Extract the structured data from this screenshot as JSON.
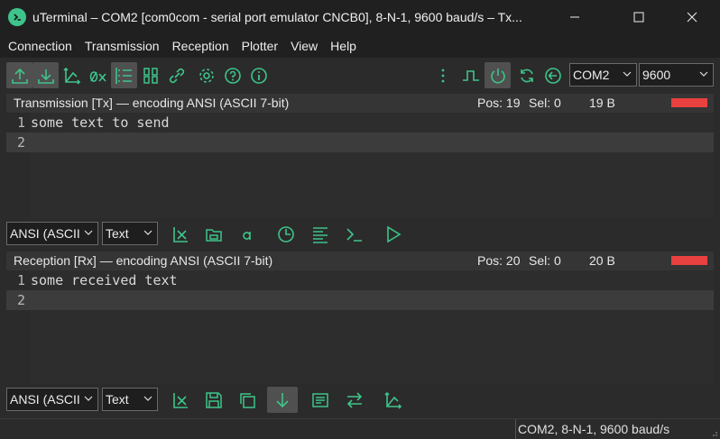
{
  "window": {
    "title": "uTerminal – COM2   [com0com - serial port emulator CNCB0], 8-N-1, 9600 baud/s – Tx..."
  },
  "menu": {
    "items": [
      "Connection",
      "Transmission",
      "Reception",
      "Plotter",
      "View",
      "Help"
    ]
  },
  "toolbar": {
    "port_value": "COM2",
    "baud_value": "9600"
  },
  "tx_panel": {
    "header": "Transmission [Tx] — encoding ANSI (ASCII 7-bit)",
    "pos": "Pos: 19",
    "sel": "Sel: 0",
    "size": "19 B",
    "lines": [
      {
        "num": "1",
        "text": "some text to send"
      },
      {
        "num": "2",
        "text": ""
      }
    ],
    "encoding_value": "ANSI (ASCII",
    "mode_value": "Text"
  },
  "rx_panel": {
    "header": "Reception [Rx] — encoding ANSI (ASCII 7-bit)",
    "pos": "Pos: 20",
    "sel": "Sel: 0",
    "size": "20 B",
    "lines": [
      {
        "num": "1",
        "text": "some received text"
      },
      {
        "num": "2",
        "text": ""
      }
    ],
    "encoding_value": "ANSI (ASCII",
    "mode_value": "Text"
  },
  "status": {
    "text": "COM2, 8-N-1, 9600 baud/s"
  },
  "colors": {
    "accent": "#3ec48a",
    "indicator": "#e8413f"
  }
}
